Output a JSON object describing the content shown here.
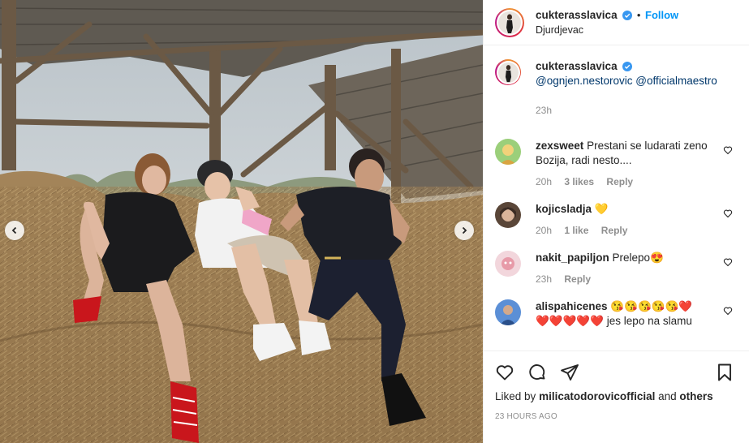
{
  "post": {
    "image_alt": "Three people sitting on hay bales under a wooden shed",
    "carousel": {
      "prev_icon": "chevron-left-icon",
      "next_icon": "chevron-right-icon"
    }
  },
  "header": {
    "username": "cukterasslavica",
    "verified": true,
    "separator": "•",
    "follow_label": "Follow",
    "location": "Djurdjevac"
  },
  "caption": {
    "username": "cukterasslavica",
    "mention1": "@ognjen.nestorovic",
    "mention2": "@officialmaestro",
    "time": "23h"
  },
  "comments": [
    {
      "username": "zexsweet",
      "text": "Prestani se ludarati zeno Bozija, radi nesto....",
      "time": "20h",
      "likes": "3 likes",
      "reply": "Reply"
    },
    {
      "username": "kojicsladja",
      "text": "💛",
      "time": "20h",
      "likes": "1 like",
      "reply": "Reply"
    },
    {
      "username": "nakit_papiljon",
      "text": "Prelepo😍",
      "time": "23h",
      "likes": "",
      "reply": "Reply"
    },
    {
      "username": "alispahicenes",
      "text": "😘😘😘😘😘❤️",
      "text2": "❤️❤️❤️❤️❤️ jes lepo na slamu",
      "time": "",
      "likes": "",
      "reply": ""
    }
  ],
  "actions": {
    "liked_prefix": "Liked by",
    "liked_user": "milicatodorovicofficial",
    "liked_and": "and",
    "liked_others": "others",
    "timestamp": "23 HOURS AGO"
  },
  "colors": {
    "accent": "#0095f6",
    "text": "#262626",
    "muted": "#8e8e8e",
    "border": "#efefef"
  }
}
